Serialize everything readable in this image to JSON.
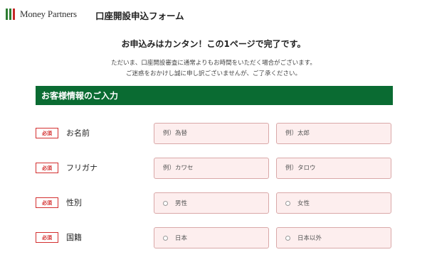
{
  "header": {
    "brand": "Money Partners",
    "title": "口座開設申込フォーム"
  },
  "intro": {
    "headline": "お申込みはカンタン！この1ページで完了です。",
    "note_line1": "ただいま、口座開設審査に通常よりもお時間をいただく場合がございます。",
    "note_line2": "ご迷惑をおかけし誠に申し訳ございませんが、ご了承ください。"
  },
  "section": {
    "title": "お客様情報のご入力"
  },
  "form": {
    "required_badge": "必須",
    "name": {
      "label": "お名前",
      "last_placeholder": "例）為替",
      "first_placeholder": "例）太郎"
    },
    "furigana": {
      "label": "フリガナ",
      "last_placeholder": "例）カワセ",
      "first_placeholder": "例）タロウ"
    },
    "gender": {
      "label": "性別",
      "option_male": "男性",
      "option_female": "女性"
    },
    "nationality": {
      "label": "国籍",
      "option_japan": "日本",
      "option_other": "日本以外"
    }
  },
  "colors": {
    "section_green": "#0a6b32",
    "required_red": "#d32f2f",
    "field_bg": "#fdeeee"
  }
}
